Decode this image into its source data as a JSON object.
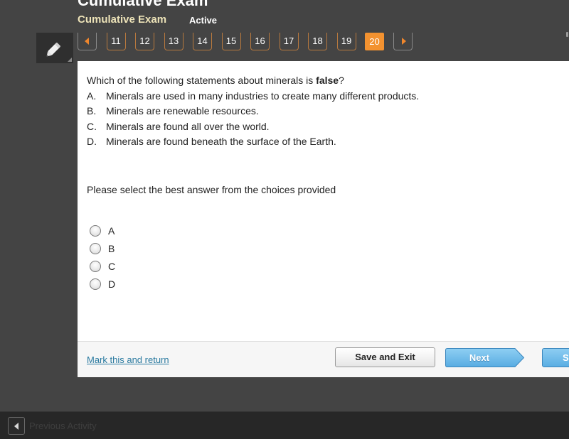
{
  "header": {
    "course_title": "Cumulative Exam",
    "exam_name": "Cumulative Exam",
    "status": "Active"
  },
  "toolbar": {
    "tool_icon": "pencil-icon"
  },
  "pagination": {
    "prev_icon": "arrow-left-icon",
    "next_icon": "arrow-right-icon",
    "pages": [
      "11",
      "12",
      "13",
      "14",
      "15",
      "16",
      "17",
      "18",
      "19",
      "20"
    ],
    "current": "20",
    "accent_color": "#f39230"
  },
  "question": {
    "prompt_before": "Which of the following statements about minerals is ",
    "prompt_bold": "false",
    "prompt_after": "?",
    "choices": [
      {
        "letter": "A.",
        "text": "Minerals are used in many industries to create many different products."
      },
      {
        "letter": "B.",
        "text": "Minerals are renewable resources."
      },
      {
        "letter": "C.",
        "text": "Minerals are found all over the world."
      },
      {
        "letter": "D.",
        "text": "Minerals are found beneath the surface of the Earth."
      }
    ],
    "instruction": "Please select the best answer from the choices provided",
    "options": [
      {
        "label": "A",
        "selected": false
      },
      {
        "label": "B",
        "selected": false
      },
      {
        "label": "C",
        "selected": false
      },
      {
        "label": "D",
        "selected": false
      }
    ]
  },
  "footer": {
    "mark_link": "Mark this and return",
    "save_exit": "Save and Exit",
    "next": "Next",
    "submit_partial": "S"
  },
  "bottom_bar": {
    "previous_activity": "Previous Activity"
  }
}
